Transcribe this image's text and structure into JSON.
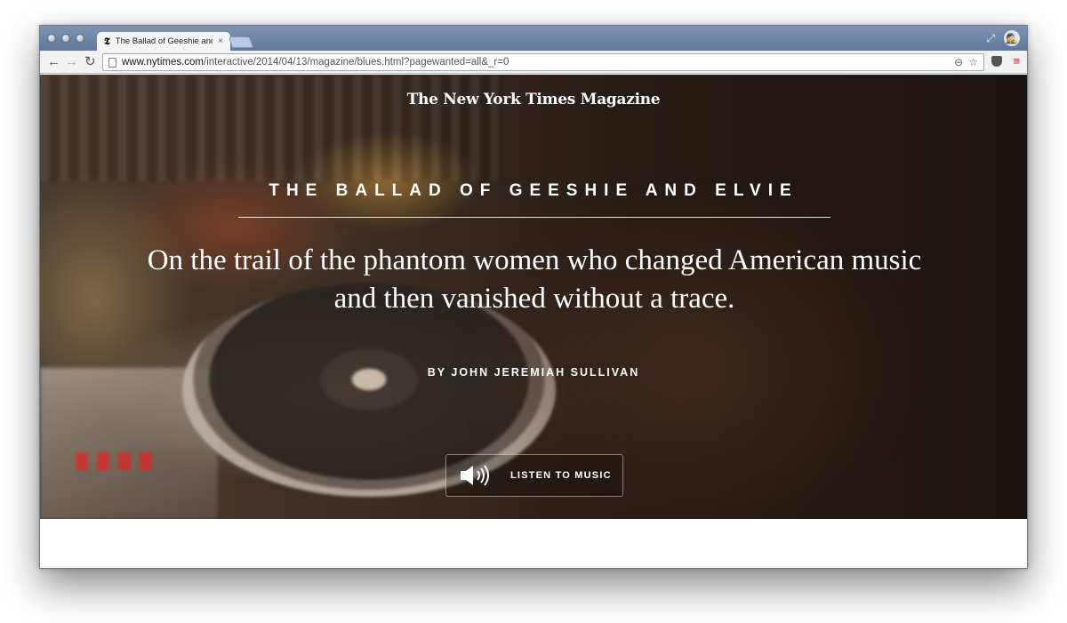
{
  "browser": {
    "tab": {
      "title": "The Ballad of Geeshie and",
      "favicon": "𝕿",
      "close": "×"
    },
    "address_bar": {
      "host": "www.nytimes.com",
      "path": "/interactive/2014/04/13/magazine/blues.html?pagewanted=all&_r=0"
    }
  },
  "hero": {
    "masthead": "The New York Times Magazine",
    "kicker": "THE BALLAD OF GEESHIE AND ELVIE",
    "dek": "On the trail of the phantom women who changed American music and then vanished without a trace.",
    "byline": "BY JOHN JEREMIAH SULLIVAN",
    "listen_button": "LISTEN TO MUSIC"
  },
  "colors": {
    "chrome_titlebar": "#6e86a8",
    "toolbar": "#f2f2f2",
    "hero_text": "#ffffff",
    "menu_accent": "#c0392b"
  }
}
